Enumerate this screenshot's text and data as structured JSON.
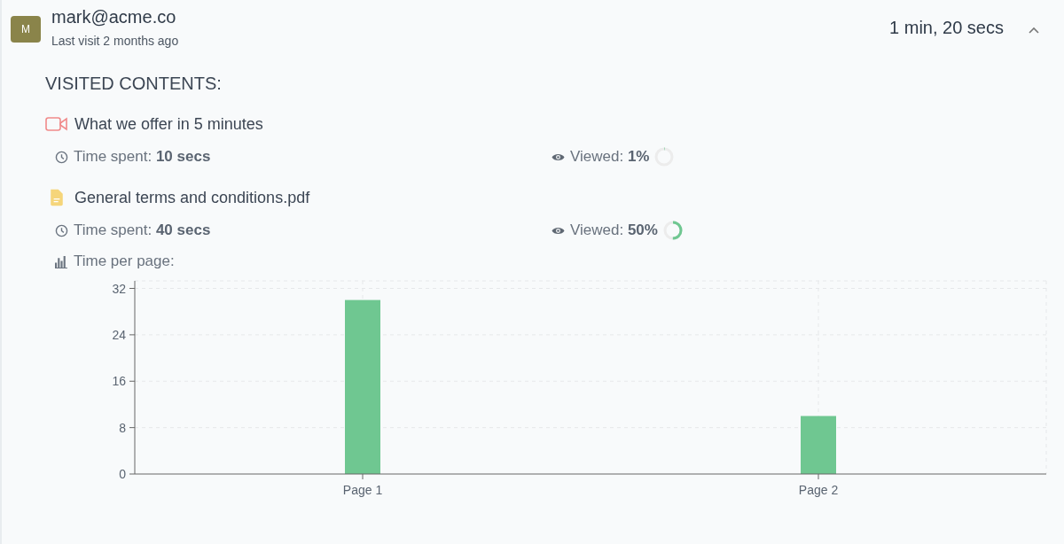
{
  "visitor": {
    "avatar_letter": "M",
    "email": "mark@acme.co",
    "last_visit": "Last visit 2 months ago",
    "total_time": "1 min, 20 secs",
    "expanded": true
  },
  "section_title": "VISITED CONTENTS:",
  "contents": [
    {
      "kind": "video",
      "title": "What we offer in 5 minutes",
      "time_label": "Time spent:",
      "time_value": "10 secs",
      "viewed_label": "Viewed:",
      "viewed_value": "1%",
      "level": 0.01
    },
    {
      "kind": "pdf",
      "title": "General terms and conditions.pdf",
      "time_label": "Time spent:",
      "time_value": "40 secs",
      "viewed_label": "Viewed:",
      "viewed_value": "50%",
      "level": 0.5,
      "per_page_label": "Time per page:",
      "chart_data": {
        "type": "bar",
        "categories": [
          "Page 1",
          "Page 2"
        ],
        "series": [
          {
            "color": "#6fc791",
            "values": [
              30,
              10
            ]
          }
        ],
        "ylim": [
          0,
          33.3
        ],
        "yticks": [
          0,
          8,
          16,
          24,
          32
        ],
        "grid": true
      }
    }
  ]
}
